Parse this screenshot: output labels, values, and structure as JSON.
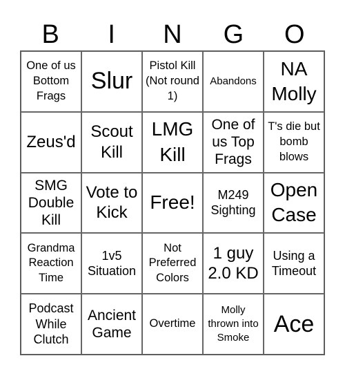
{
  "header": {
    "letters": [
      "B",
      "I",
      "N",
      "G",
      "O"
    ]
  },
  "grid": {
    "rows": [
      [
        "One of us Bottom Frags",
        "Slur",
        "Pistol Kill (Not round 1)",
        "Abandons",
        "NA Molly"
      ],
      [
        "Zeus'd",
        "Scout Kill",
        "LMG Kill",
        "One of us Top Frags",
        "T's die but bomb blows"
      ],
      [
        "SMG Double Kill",
        "Vote to Kick",
        "Free!",
        "M249 Sighting",
        "Open Case"
      ],
      [
        "Grandma Reaction Time",
        "1v5 Situation",
        "Not Preferred Colors",
        "1 guy 2.0 KD",
        "Using a Timeout"
      ],
      [
        "Podcast While Clutch",
        "Ancient Game",
        "Overtime",
        "Molly thrown into Smoke",
        "Ace"
      ]
    ]
  }
}
